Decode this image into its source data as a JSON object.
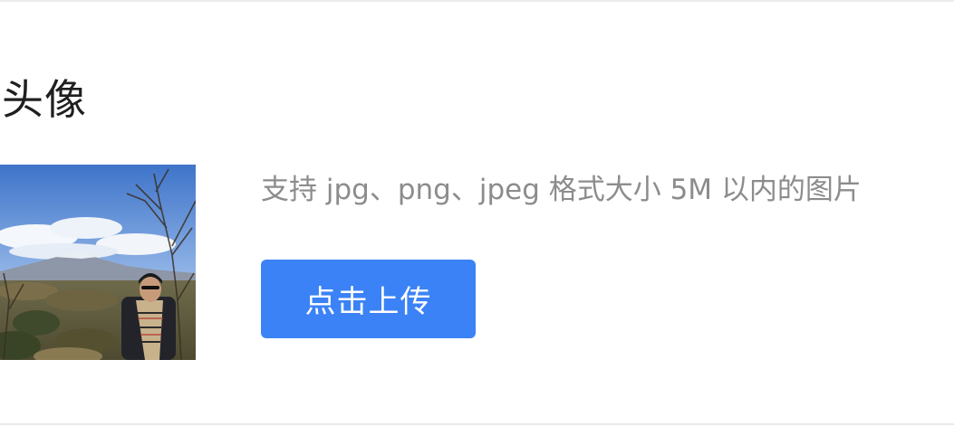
{
  "section": {
    "title": "头像"
  },
  "avatar": {
    "alt": "avatar"
  },
  "upload": {
    "hint": "支持 jpg、png、jpeg 格式大小 5M 以内的图片",
    "button_label": "点击上传",
    "button_color": "#3b82f6"
  }
}
